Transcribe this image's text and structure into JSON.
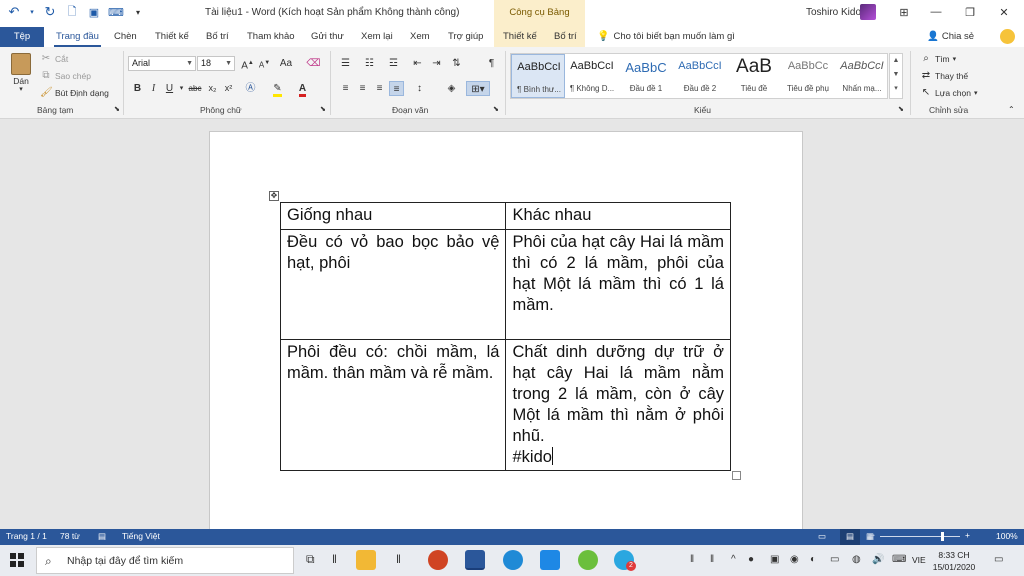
{
  "title_bar": {
    "doc_title": "Tài liệu1  -  Word (Kích hoạt Sản phẩm Không thành công)",
    "contextual_group": "Công cụ Bảng",
    "user_name": "Toshiro Kido"
  },
  "tabs": {
    "file": "Tệp",
    "items": [
      "Trang đầu",
      "Chèn",
      "Thiết kế",
      "Bố trí",
      "Tham khảo",
      "Gửi thư",
      "Xem lại",
      "Xem",
      "Trợ giúp",
      "Thiết kế",
      "Bố trí"
    ],
    "active_index": 0,
    "tell_me": "Cho tôi biết bạn muốn làm gì",
    "share": "Chia sẻ"
  },
  "ribbon": {
    "clipboard": {
      "label": "Bảng tạm",
      "paste": "Dán",
      "cut": "Cắt",
      "copy": "Sao chép",
      "format_painter": "Bút Định dạng"
    },
    "font": {
      "label": "Phông chữ",
      "font_name": "Arial",
      "font_size": "18",
      "bold": "B",
      "italic": "I",
      "underline": "U",
      "strike": "abc",
      "subscript": "x₂",
      "superscript": "x²",
      "case": "Aa",
      "grow": "A",
      "shrink": "A",
      "font_color": "A"
    },
    "paragraph": {
      "label": "Đoạn văn"
    },
    "styles": {
      "label": "Kiểu",
      "items": [
        {
          "preview": "AaBbCcI",
          "name": "¶ Bình thư..."
        },
        {
          "preview": "AaBbCcI",
          "name": "¶ Không D..."
        },
        {
          "preview": "AaBbC",
          "name": "Đầu đề 1"
        },
        {
          "preview": "AaBbCcI",
          "name": "Đầu đề 2"
        },
        {
          "preview": "AaB",
          "name": "Tiêu đề"
        },
        {
          "preview": "AaBbCc",
          "name": "Tiêu đề phụ"
        },
        {
          "preview": "AaBbCcI",
          "name": "Nhấn mạ..."
        }
      ]
    },
    "editing": {
      "label": "Chỉnh sửa",
      "find": "Tìm",
      "replace": "Thay thế",
      "select": "Lựa chọn"
    }
  },
  "document": {
    "table": {
      "headers": [
        "Giống nhau",
        "Khác nhau"
      ],
      "rows": [
        [
          "Đều có vỏ bao bọc bảo vệ hạt, phôi",
          "Phôi của hạt cây Hai lá mầm thì có 2 lá mầm, phôi của hạt Một lá mầm thì có 1 lá mầm."
        ],
        [
          "Phôi đều có: chồi mầm, lá mầm. thân mầm và rễ mầm.",
          "Chất dinh dưỡng dự trữ ở hạt cây Hai lá mầm nằm trong 2 lá mầm, còn ở cây Một lá mầm thì nằm ở phôi nhũ."
        ]
      ],
      "tag": "#kido"
    }
  },
  "status_bar": {
    "page": "Trang 1 / 1",
    "words": "78 từ",
    "language": "Tiếng Việt",
    "zoom": "100%"
  },
  "taskbar": {
    "search_placeholder": "Nhập tại đây để tìm kiếm",
    "input_lang": "VIE",
    "time": "8:33 CH",
    "date": "15/01/2020",
    "notification_badge": "2"
  },
  "colors": {
    "word_blue": "#2b579a",
    "contextual": "#fbeecb",
    "font_color_red": "#d62020",
    "highlight_yellow": "#ffe600"
  }
}
